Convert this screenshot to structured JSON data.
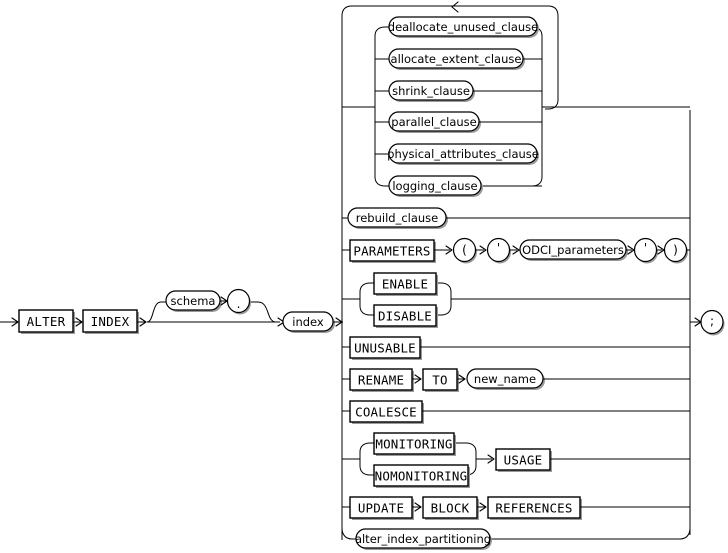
{
  "diagram": {
    "kind": "railroad-syntax-diagram",
    "title": "alter_index",
    "colors": {
      "background": "#ffffff",
      "line": "#000000",
      "shadow": "#9a9a9a",
      "box_fill": "#ffffff"
    },
    "entry_sequence": [
      {
        "id": "alter",
        "type": "keyword",
        "label": "ALTER"
      },
      {
        "id": "index_kw",
        "type": "keyword",
        "label": "INDEX"
      },
      {
        "id": "schema",
        "type": "nonterminal",
        "label": "schema",
        "optional": true
      },
      {
        "id": "dot",
        "type": "punctuation",
        "label": ".",
        "optional": true
      },
      {
        "id": "index",
        "type": "nonterminal",
        "label": "index"
      }
    ],
    "terminator": {
      "id": "semicolon",
      "type": "punctuation",
      "label": ";"
    },
    "repeating_group": {
      "loop": true,
      "loop_arrow": "left",
      "items": [
        {
          "id": "deallocate_unused_clause",
          "type": "nonterminal",
          "label": "deallocate_unused_clause"
        },
        {
          "id": "allocate_extent_clause",
          "type": "nonterminal",
          "label": "allocate_extent_clause"
        },
        {
          "id": "shrink_clause",
          "type": "nonterminal",
          "label": "shrink_clause"
        },
        {
          "id": "parallel_clause",
          "type": "nonterminal",
          "label": "parallel_clause"
        },
        {
          "id": "physical_attributes_clause",
          "type": "nonterminal",
          "label": "physical_attributes_clause"
        },
        {
          "id": "logging_clause",
          "type": "nonterminal",
          "label": "logging_clause"
        }
      ]
    },
    "alternatives": [
      {
        "id": "rebuild",
        "row": 1,
        "items": [
          {
            "id": "rebuild_clause",
            "type": "nonterminal",
            "label": "rebuild_clause"
          }
        ]
      },
      {
        "id": "parameters",
        "row": 2,
        "items": [
          {
            "id": "parameters_kw",
            "type": "keyword",
            "label": "PARAMETERS"
          },
          {
            "id": "lparen",
            "type": "punctuation",
            "label": "("
          },
          {
            "id": "quote_open",
            "type": "punctuation",
            "label": "'"
          },
          {
            "id": "odci_parameters",
            "type": "nonterminal",
            "label": "ODCI_parameters"
          },
          {
            "id": "quote_close",
            "type": "punctuation",
            "label": "'"
          },
          {
            "id": "rparen",
            "type": "punctuation",
            "label": ")"
          }
        ]
      },
      {
        "id": "enable_disable",
        "row": 3,
        "choice": [
          {
            "id": "enable",
            "type": "keyword",
            "label": "ENABLE"
          },
          {
            "id": "disable",
            "type": "keyword",
            "label": "DISABLE"
          }
        ]
      },
      {
        "id": "unusable",
        "row": 4,
        "items": [
          {
            "id": "unusable_kw",
            "type": "keyword",
            "label": "UNUSABLE"
          }
        ]
      },
      {
        "id": "rename",
        "row": 5,
        "items": [
          {
            "id": "rename_kw",
            "type": "keyword",
            "label": "RENAME"
          },
          {
            "id": "to_kw",
            "type": "keyword",
            "label": "TO"
          },
          {
            "id": "new_name",
            "type": "nonterminal",
            "label": "new_name"
          }
        ]
      },
      {
        "id": "coalesce",
        "row": 6,
        "items": [
          {
            "id": "coalesce_kw",
            "type": "keyword",
            "label": "COALESCE"
          }
        ]
      },
      {
        "id": "monitoring_usage",
        "row": 7,
        "choice": [
          {
            "id": "monitoring",
            "type": "keyword",
            "label": "MONITORING"
          },
          {
            "id": "nomonitoring",
            "type": "keyword",
            "label": "NOMONITORING"
          }
        ],
        "then": [
          {
            "id": "usage_kw",
            "type": "keyword",
            "label": "USAGE"
          }
        ]
      },
      {
        "id": "update_block_references",
        "row": 8,
        "items": [
          {
            "id": "update_kw",
            "type": "keyword",
            "label": "UPDATE"
          },
          {
            "id": "block_kw",
            "type": "keyword",
            "label": "BLOCK"
          },
          {
            "id": "references_kw",
            "type": "keyword",
            "label": "REFERENCES"
          }
        ]
      },
      {
        "id": "alter_index_partitioning",
        "row": 9,
        "items": [
          {
            "id": "alter_index_partitioning_nt",
            "type": "nonterminal",
            "label": "alter_index_partitioning"
          }
        ]
      }
    ]
  }
}
